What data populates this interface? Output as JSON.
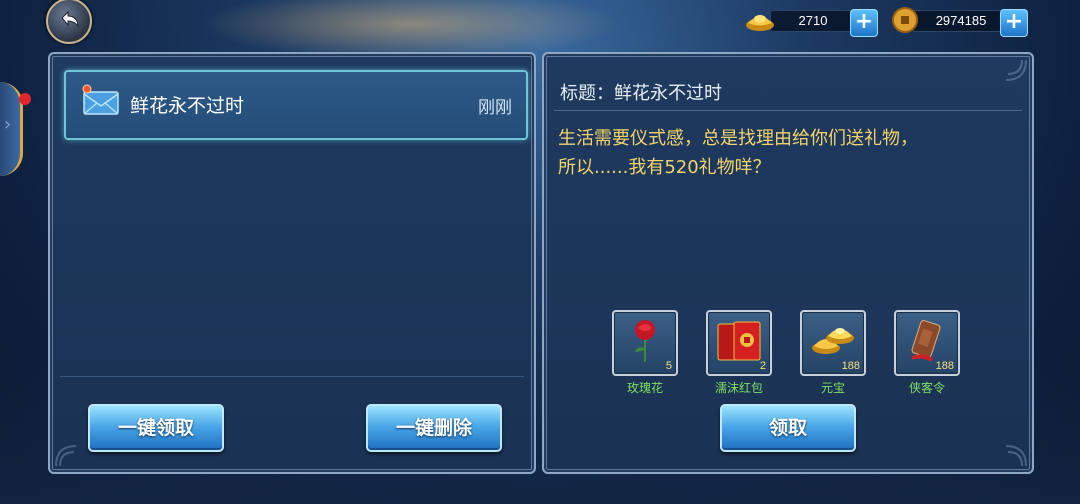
{
  "currencies": [
    {
      "icon": "gold-ingot-icon",
      "value": "2710"
    },
    {
      "icon": "copper-coin-icon",
      "value": "2974185"
    }
  ],
  "mail_list": [
    {
      "title": "鲜花永不过时",
      "time": "刚刚",
      "unread": true
    }
  ],
  "left_buttons": {
    "claim_all": "一键领取",
    "delete_all": "一键删除"
  },
  "mail_detail": {
    "title_label": "标题：鲜花永不过时",
    "body": "生活需要仪式感，总是找理由给你们送礼物，\n所以......我有520礼物咩？",
    "rewards": [
      {
        "name": "玫瑰花",
        "qty": "5",
        "icon": "rose-icon"
      },
      {
        "name": "濡沫红包",
        "qty": "2",
        "icon": "red-envelope-icon"
      },
      {
        "name": "元宝",
        "qty": "188",
        "icon": "gold-ingot-icon"
      },
      {
        "name": "侠客令",
        "qty": "188",
        "icon": "token-scroll-icon"
      }
    ],
    "claim_label": "领取"
  },
  "colors": {
    "accent_blue": "#4aa8e8",
    "body_text": "#f3d36a",
    "reward_name": "#7fe060",
    "notify_dot": "#e0252b"
  }
}
